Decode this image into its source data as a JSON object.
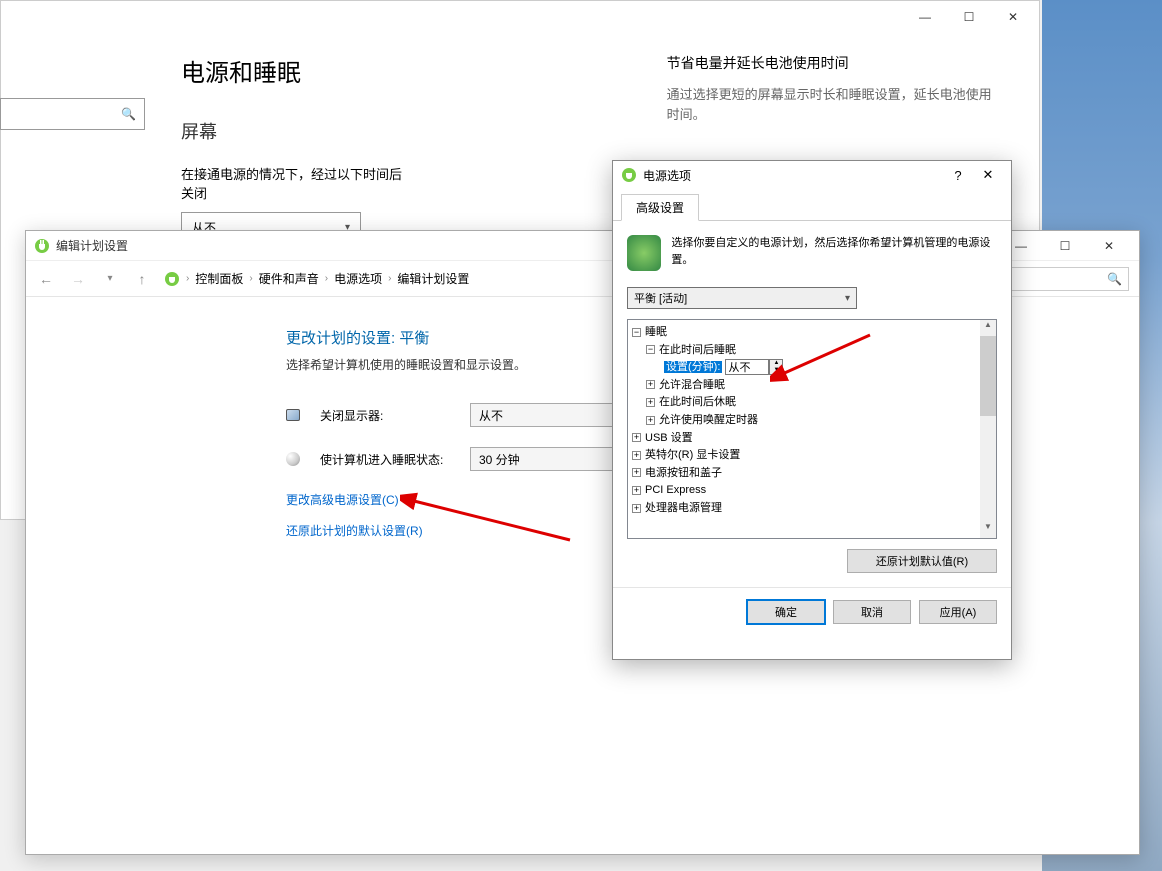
{
  "desktop": {},
  "settings_window": {
    "title": "电源和睡眠",
    "screen_heading": "屏幕",
    "screen_label": "在接通电源的情况下，经过以下时间后关闭",
    "screen_value": "从不",
    "tips_heading": "节省电量并延长电池使用时间",
    "tips_text": "通过选择更短的屏幕显示时长和睡眠设置，延长电池使用时间。"
  },
  "editplan_window": {
    "title": "编辑计划设置",
    "breadcrumb": [
      "控制面板",
      "硬件和声音",
      "电源选项",
      "编辑计划设置"
    ],
    "heading": "更改计划的设置: 平衡",
    "subtitle": "选择希望计算机使用的睡眠设置和显示设置。",
    "row_display_label": "关闭显示器:",
    "row_display_value": "从不",
    "row_sleep_label": "使计算机进入睡眠状态:",
    "row_sleep_value": "30 分钟",
    "link_advanced": "更改高级电源设置(C)",
    "link_restore": "还原此计划的默认设置(R)",
    "window_buttons": {
      "min": "—",
      "max": "☐",
      "close": "✕"
    }
  },
  "poweropt_dialog": {
    "title": "电源选项",
    "help": "?",
    "close": "✕",
    "tab": "高级设置",
    "intro": "选择你要自定义的电源计划，然后选择你希望计算机管理的电源设置。",
    "plan_select": "平衡 [活动]",
    "tree": {
      "sleep": "睡眠",
      "sleep_after": "在此时间后睡眠",
      "setting_label": "设置(分钟):",
      "setting_value": "从不",
      "hybrid": "允许混合睡眠",
      "hibernate_after": "在此时间后休眠",
      "wake_timers": "允许使用唤醒定时器",
      "usb": "USB 设置",
      "intel_gfx": "英特尔(R) 显卡设置",
      "power_buttons": "电源按钮和盖子",
      "pci": "PCI Express",
      "cpu": "处理器电源管理"
    },
    "restore_defaults": "还原计划默认值(R)",
    "buttons": {
      "ok": "确定",
      "cancel": "取消",
      "apply": "应用(A)"
    }
  }
}
